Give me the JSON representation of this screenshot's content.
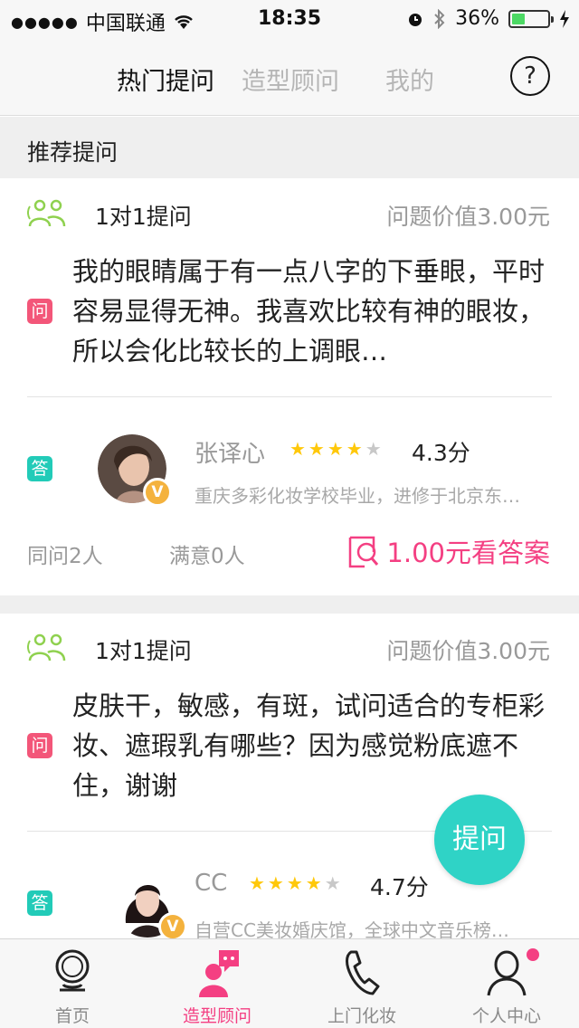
{
  "status_bar": {
    "signal": "●●●●●",
    "carrier": "中国联通",
    "time": "18:35",
    "battery_percent": "36%",
    "battery_level": 0.36
  },
  "nav": {
    "tabs": [
      {
        "label": "热门提问",
        "active": true
      },
      {
        "label": "造型顾问",
        "active": false
      },
      {
        "label": "我的",
        "active": false
      }
    ],
    "help_label": "?"
  },
  "section_title": "推荐提问",
  "questions": [
    {
      "type": "1对1提问",
      "value": "问题价值3.00元",
      "q_badge": "问",
      "text": "我的眼睛属于有一点八字的下垂眼，平时容易显得无神。我喜欢比较有神的眼妆，所以会化比较长的上调眼…",
      "a_badge": "答",
      "expert": {
        "name": "张译心",
        "stars": 4.5,
        "rating": "4.3分",
        "desc": "重庆多彩化妆学校毕业，进修于北京东…",
        "verified": "V"
      },
      "same_ask": "同问2人",
      "satisfied": "满意0人",
      "answer_price": "1.00元看答案"
    },
    {
      "type": "1对1提问",
      "value": "问题价值3.00元",
      "q_badge": "问",
      "text": "皮肤干，敏感，有斑，试问适合的专柜彩妆、遮瑕乳有哪些？因为感觉粉底遮不住，谢谢",
      "a_badge": "答",
      "expert": {
        "name": "CC",
        "stars": 4.5,
        "rating": "4.7分",
        "desc": "自营CC美妆婚庆馆，全球中文音乐榜…",
        "verified": "V"
      }
    }
  ],
  "fab_label": "提问",
  "tabbar": [
    {
      "label": "首页",
      "icon": "mirror-icon",
      "active": false
    },
    {
      "label": "造型顾问",
      "icon": "consultant-icon",
      "active": true
    },
    {
      "label": "上门化妆",
      "icon": "phone-icon",
      "active": false
    },
    {
      "label": "个人中心",
      "icon": "person-icon",
      "active": false
    }
  ],
  "colors": {
    "accent_pink": "#f43f82",
    "accent_teal": "#2fd3c6",
    "question_badge": "#f35679",
    "answer_badge": "#22cbb8",
    "star": "#ffc80a"
  }
}
